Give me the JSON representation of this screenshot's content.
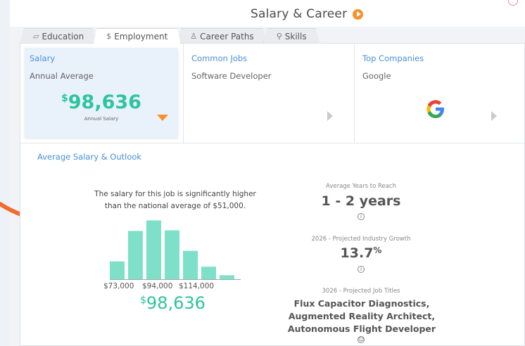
{
  "header": {
    "title": "Salary & Career"
  },
  "tabs": [
    {
      "label": "Education",
      "icon": "graduation-cap-icon"
    },
    {
      "label": "Employment",
      "icon": "dollar-icon"
    },
    {
      "label": "Career Paths",
      "icon": "person-icon"
    },
    {
      "label": "Skills",
      "icon": "wrench-icon"
    }
  ],
  "active_tab": "Employment",
  "cards": {
    "salary": {
      "heading": "Salary",
      "sub": "Annual Average",
      "currency": "$",
      "amount": "98,636",
      "amount_label": "Annual Salary"
    },
    "jobs": {
      "heading": "Common Jobs",
      "sub": "Software Developer"
    },
    "companies": {
      "heading": "Top Companies",
      "sub": "Google"
    }
  },
  "outlook": {
    "title": "Average Salary & Outlook",
    "blurb_line1": "The salary for this job is significantly higher",
    "blurb_line2": "than the national average of $51,000.",
    "x_labels": [
      "$73,000",
      "$94,000",
      "$114,000"
    ],
    "currency": "$",
    "salary": "98,636"
  },
  "stats": {
    "years_label": "Average Years to Reach",
    "years_value": "1 - 2 years",
    "growth_label": "2026 - Projected Industry Growth",
    "growth_value": "13.7",
    "growth_unit": "%",
    "titles_label": "3026 - Projected Job Titles",
    "titles_line1": "Flux Capacitor Diagnostics,",
    "titles_line2": "Augmented Reality Architect,",
    "titles_line3": "Autonomous Flight Developer"
  },
  "chart_data": {
    "type": "bar",
    "title": "",
    "values": [
      28,
      74,
      90,
      75,
      44,
      20,
      7
    ],
    "color": "#7ee0c8"
  },
  "colors": {
    "accent": "#2ec4a0",
    "link": "#4a90d9",
    "orange": "#f5902a"
  }
}
